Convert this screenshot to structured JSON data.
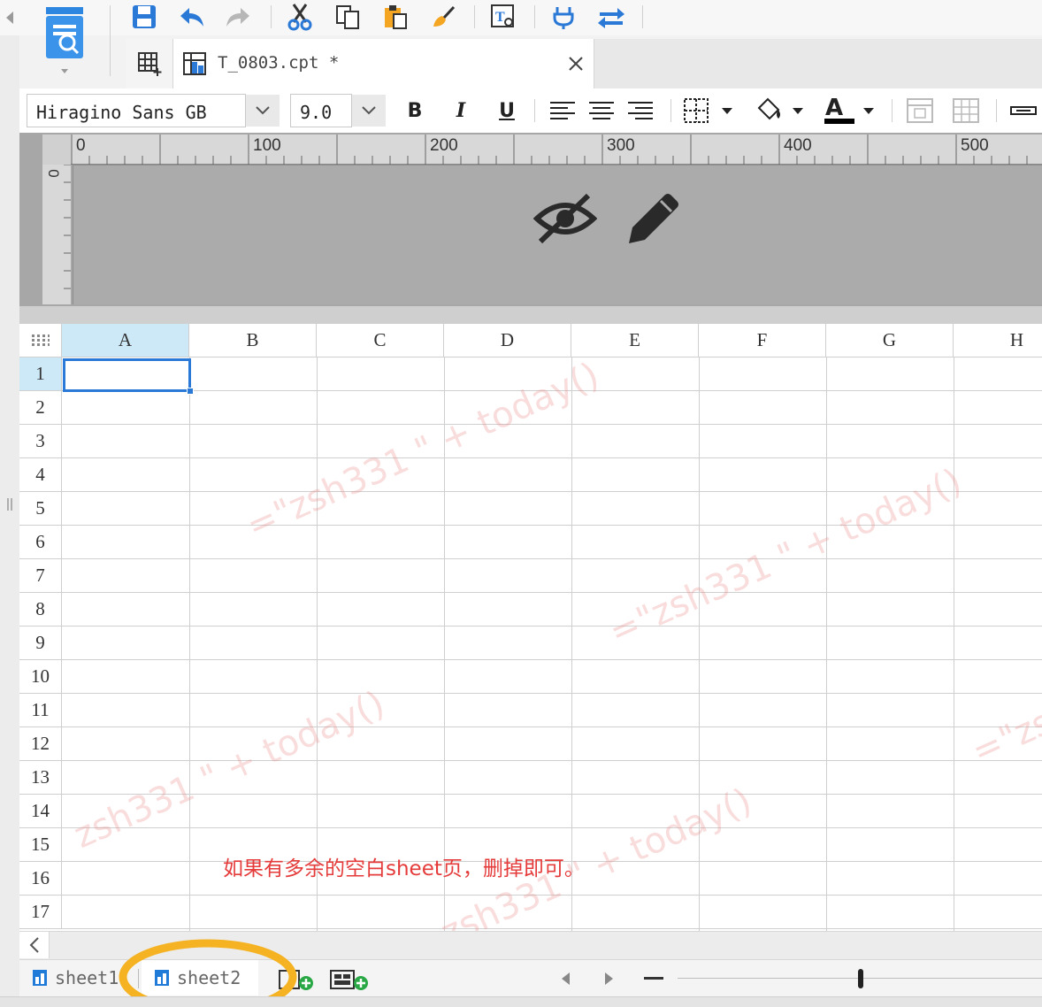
{
  "file_tab": {
    "title": "T_0803.cpt *"
  },
  "font": {
    "family": "Hiragino Sans GB",
    "size": "9.0"
  },
  "ruler": {
    "horizontal_labels": [
      "0",
      "100",
      "200",
      "300",
      "400",
      "500"
    ],
    "vertical_label": "0"
  },
  "grid": {
    "columns": [
      "A",
      "B",
      "C",
      "D",
      "E",
      "F",
      "G",
      "H"
    ],
    "rows": [
      "1",
      "2",
      "3",
      "4",
      "5",
      "6",
      "7",
      "8",
      "9",
      "10",
      "11",
      "12",
      "13",
      "14",
      "15",
      "16",
      "17"
    ],
    "selected_cell": "A1"
  },
  "watermarks": [
    "=\"zsh331 \" + today()",
    "=\"zsh331 \" + today()",
    "zsh331 \" + today()",
    "=\"zsh",
    "zsh331 \" + today()"
  ],
  "annotation": {
    "note": "如果有多余的空白sheet页，删掉即可。",
    "highlight_color": "#f5b324"
  },
  "sheets": [
    {
      "name": "sheet1"
    },
    {
      "name": "sheet2"
    }
  ],
  "colors": {
    "accent_blue": "#1f7ad8",
    "selection_blue": "#2b79d6",
    "header_highlight": "#cde8f7",
    "note_red": "#e53b3b"
  }
}
